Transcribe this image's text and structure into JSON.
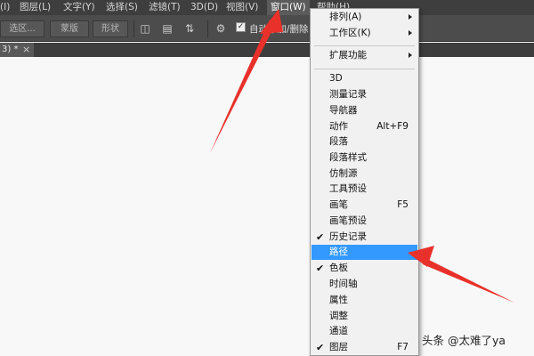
{
  "menubar": {
    "items": [
      {
        "label": "(I)"
      },
      {
        "label": "图层(L)"
      },
      {
        "label": "文字(Y)"
      },
      {
        "label": "选择(S)"
      },
      {
        "label": "滤镜(T)"
      },
      {
        "label": "3D(D)"
      },
      {
        "label": "视图(V)"
      },
      {
        "label": "窗口(W)"
      },
      {
        "label": "帮助(H)"
      }
    ]
  },
  "options_bar": {
    "select_area_label": "选区...",
    "mask_label": "蒙版",
    "shape_label": "形状",
    "auto_add_delete_label": "自动添加/删除"
  },
  "tab": {
    "label": "3) *",
    "close": "×"
  },
  "window_menu": {
    "items": [
      {
        "label": "排列(A)",
        "submenu": true
      },
      {
        "label": "工作区(K)",
        "submenu": true
      },
      {
        "label": "扩展功能",
        "submenu": true
      },
      {
        "label": "3D"
      },
      {
        "label": "测量记录"
      },
      {
        "label": "导航器"
      },
      {
        "label": "动作",
        "shortcut": "Alt+F9"
      },
      {
        "label": "段落"
      },
      {
        "label": "段落样式"
      },
      {
        "label": "仿制源"
      },
      {
        "label": "工具预设"
      },
      {
        "label": "画笔",
        "shortcut": "F5"
      },
      {
        "label": "画笔预设"
      },
      {
        "label": "历史记录",
        "checked": true
      },
      {
        "label": "路径",
        "highlighted": true
      },
      {
        "label": "色板",
        "checked": true
      },
      {
        "label": "时间轴"
      },
      {
        "label": "属性"
      },
      {
        "label": "调整"
      },
      {
        "label": "通道"
      },
      {
        "label": "图层",
        "shortcut": "F7",
        "checked": true
      }
    ]
  },
  "watermark": "头条 @太难了ya",
  "colors": {
    "menubar_bg": "#3e3e3e",
    "menu_highlight": "#3399ff",
    "annotation_arrow": "#e8312a"
  }
}
